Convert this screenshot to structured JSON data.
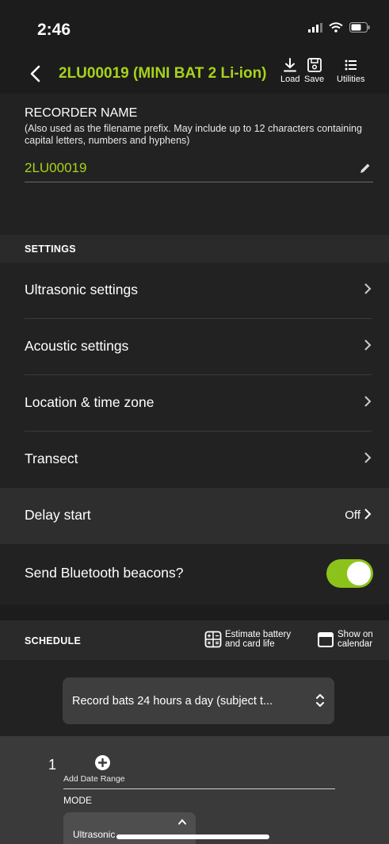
{
  "status_bar": {
    "time": "2:46"
  },
  "nav": {
    "title": "2LU00019 (MINI BAT 2 Li-ion)",
    "load_label": "Load",
    "save_label": "Save",
    "utilities_label": "Utilities"
  },
  "recorder": {
    "title": "RECORDER NAME",
    "help_text": "(Also used as the filename prefix. May include up to 12 characters containing capital letters, numbers and hyphens)",
    "value": "2LU00019"
  },
  "settings": {
    "header": "SETTINGS",
    "items": [
      {
        "label": "Ultrasonic settings"
      },
      {
        "label": "Acoustic settings"
      },
      {
        "label": "Location & time zone"
      },
      {
        "label": "Transect"
      }
    ],
    "delay_start": {
      "label": "Delay start",
      "value": "Off"
    },
    "bluetooth": {
      "label": "Send Bluetooth beacons?",
      "enabled": true
    }
  },
  "schedule": {
    "header": "SCHEDULE",
    "estimate_label_line1": "Estimate battery",
    "estimate_label_line2": "and card life",
    "calendar_label_line1": "Show on",
    "calendar_label_line2": "calendar",
    "selected": "Record bats 24 hours a day (subject t...",
    "range_number": "1",
    "add_range_label": "Add Date Range",
    "mode_label": "MODE",
    "mode_value": "Ultrasonic"
  },
  "colors": {
    "accent": "#a8d21a",
    "toggle_on": "#8cc31a"
  }
}
